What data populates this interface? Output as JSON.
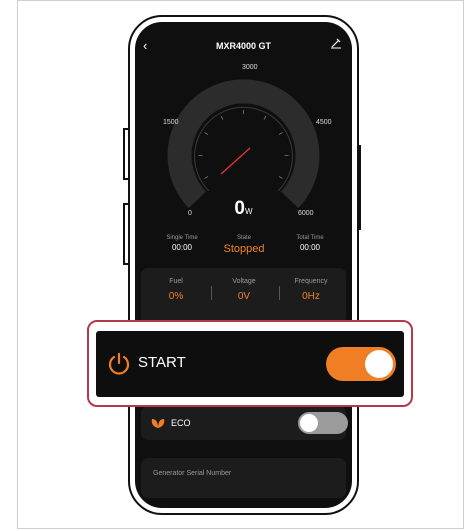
{
  "header": {
    "title": "MXR4000 GT",
    "back_icon": "chevron-left-icon",
    "edit_icon": "edit-icon"
  },
  "gauge": {
    "ticks": {
      "t0": "0",
      "t1500": "1500",
      "t3000": "3000",
      "t4500": "4500",
      "t6000": "6000"
    },
    "power_value": "0",
    "power_unit": "W"
  },
  "status": {
    "single_time_label": "Single Time",
    "single_time_value": "00:00",
    "state_label": "State",
    "state_value": "Stopped",
    "total_time_label": "Total Time",
    "total_time_value": "00:00"
  },
  "metrics": {
    "fuel_label": "Fuel",
    "fuel_value": "0%",
    "voltage_label": "Voltage",
    "voltage_value": "0V",
    "frequency_label": "Frequency",
    "frequency_value": "0Hz"
  },
  "controls": {
    "start_label": "START",
    "start_on": true,
    "eco_label": "ECO",
    "eco_on": false
  },
  "serial": {
    "label": "Generator Serial Number"
  },
  "colors": {
    "accent": "#ef7e24",
    "highlight_border": "#b33a4d",
    "screen_bg": "#0f0f0f"
  }
}
